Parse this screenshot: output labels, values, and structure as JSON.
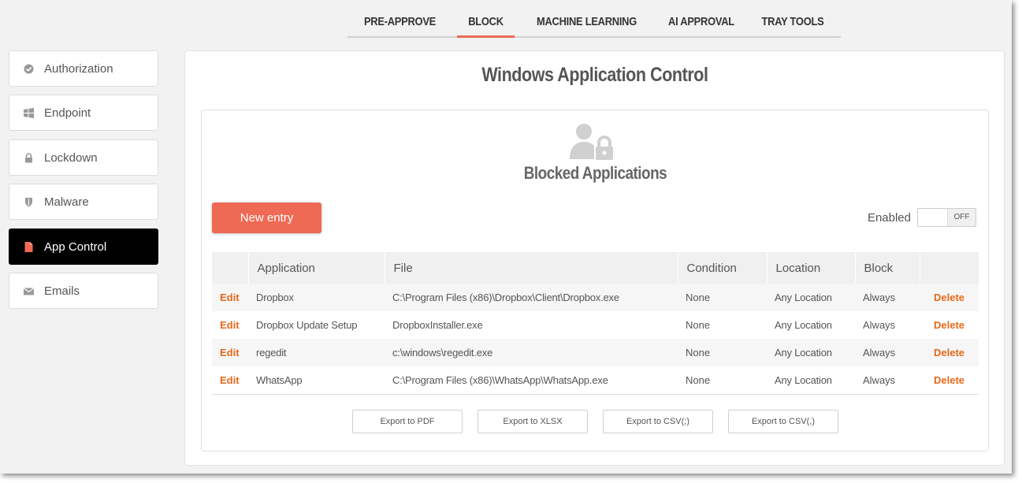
{
  "top_tabs": [
    {
      "label": "PRE-APPROVE",
      "active": false
    },
    {
      "label": "BLOCK",
      "active": true
    },
    {
      "label": "MACHINE LEARNING",
      "active": false
    },
    {
      "label": "AI APPROVAL",
      "active": false
    },
    {
      "label": "TRAY TOOLS",
      "active": false
    }
  ],
  "sidebar": {
    "items": [
      {
        "label": "Authorization",
        "icon": "check-circle-icon"
      },
      {
        "label": "Endpoint",
        "icon": "windows-icon"
      },
      {
        "label": "Lockdown",
        "icon": "lock-icon"
      },
      {
        "label": "Malware",
        "icon": "shield-icon"
      },
      {
        "label": "App Control",
        "icon": "file-icon",
        "active": true
      },
      {
        "label": "Emails",
        "icon": "envelope-icon"
      }
    ]
  },
  "main": {
    "title": "Windows Application Control",
    "subtitle": "Blocked Applications",
    "new_entry_label": "New entry",
    "enabled_label": "Enabled",
    "toggle_state": "OFF",
    "table": {
      "headers": [
        "",
        "Application",
        "File",
        "Condition",
        "Location",
        "Block",
        ""
      ],
      "edit_label": "Edit",
      "delete_label": "Delete",
      "rows": [
        {
          "application": "Dropbox",
          "file": "C:\\Program Files (x86)\\Dropbox\\Client\\Dropbox.exe",
          "condition": "None",
          "location": "Any Location",
          "block": "Always"
        },
        {
          "application": "Dropbox Update Setup",
          "file": "DropboxInstaller.exe",
          "condition": "None",
          "location": "Any Location",
          "block": "Always"
        },
        {
          "application": "regedit",
          "file": "c:\\windows\\regedit.exe",
          "condition": "None",
          "location": "Any Location",
          "block": "Always"
        },
        {
          "application": "WhatsApp",
          "file": "C:\\Program Files (x86)\\WhatsApp\\WhatsApp.exe",
          "condition": "None",
          "location": "Any Location",
          "block": "Always"
        }
      ]
    },
    "exports": [
      "Export to PDF",
      "Export to XLSX",
      "Export to CSV(;)",
      "Export to CSV(,)"
    ]
  },
  "colors": {
    "accent": "#ee6a55",
    "link": "#e8681a",
    "active_sidebar": "#000000"
  }
}
